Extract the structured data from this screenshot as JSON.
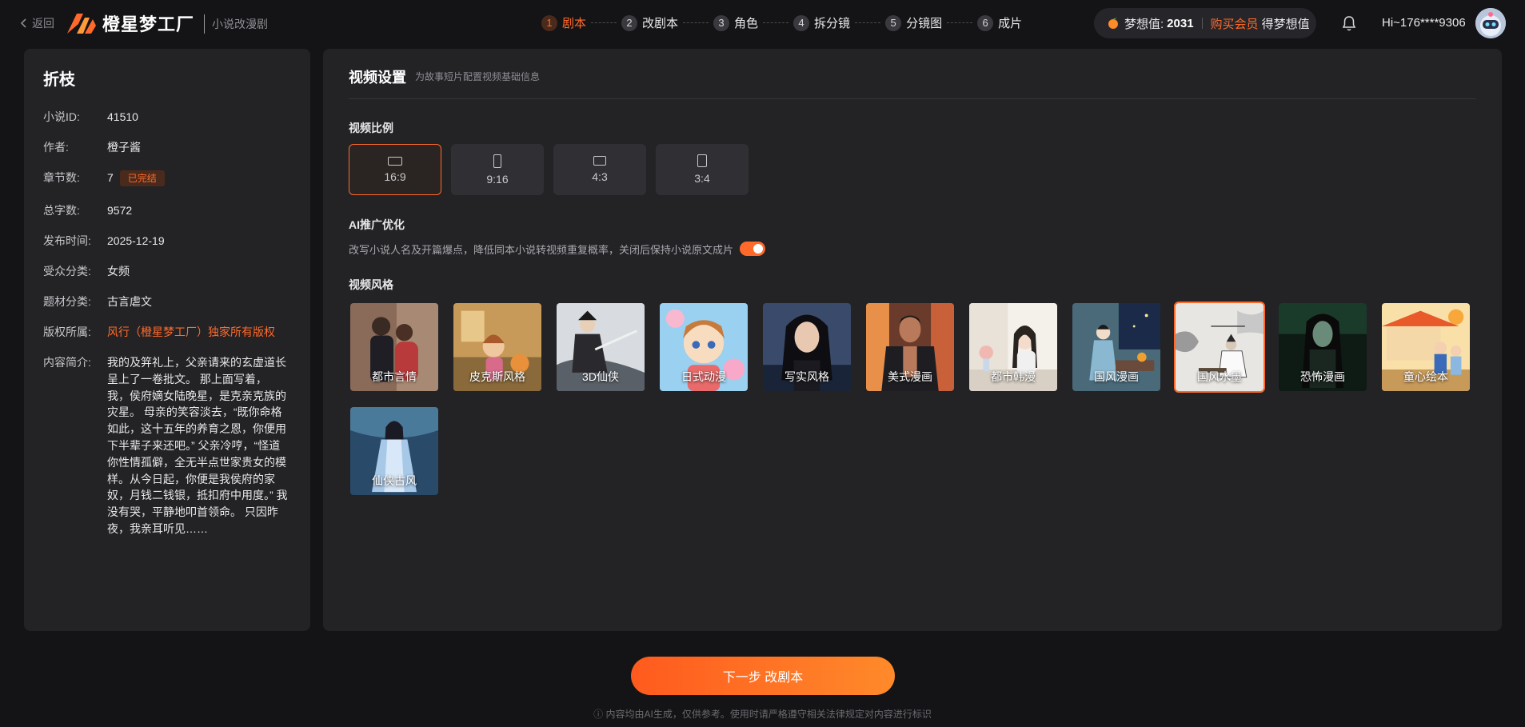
{
  "header": {
    "back_label": "返回",
    "logo_text": "橙星梦工厂",
    "logo_subtitle": "小说改漫剧",
    "steps": [
      {
        "num": "1",
        "label": "剧本"
      },
      {
        "num": "2",
        "label": "改剧本"
      },
      {
        "num": "3",
        "label": "角色"
      },
      {
        "num": "4",
        "label": "拆分镜"
      },
      {
        "num": "5",
        "label": "分镜图"
      },
      {
        "num": "6",
        "label": "成片"
      }
    ],
    "dream_label": "梦想值:",
    "dream_value": "2031",
    "buy_member": "购买会员",
    "earn_dream": "得梦想值",
    "user_greeting": "Hi~176****9306"
  },
  "novel": {
    "title": "折枝",
    "fields": [
      {
        "key": "小说ID:",
        "value": "41510"
      },
      {
        "key": "作者:",
        "value": "橙子酱"
      },
      {
        "key": "章节数:",
        "value": "7",
        "badge": "已完结"
      },
      {
        "key": "总字数:",
        "value": "9572"
      },
      {
        "key": "发布时间:",
        "value": "2025-12-19"
      },
      {
        "key": "受众分类:",
        "value": "女频"
      },
      {
        "key": "题材分类:",
        "value": "古言虐文"
      },
      {
        "key": "版权所属:",
        "value": "风行（橙星梦工厂）独家所有版权"
      }
    ],
    "summary_key": "内容简介:",
    "summary": "我的及笄礼上，父亲请来的玄虚道长呈上了一卷批文。 那上面写着，我，侯府嫡女陆晚星，是克亲克族的灾星。 母亲的笑容淡去，“既你命格如此，这十五年的养育之恩，你便用下半辈子来还吧。” 父亲冷哼，“怪道你性情孤僻，全无半点世家贵女的模样。从今日起，你便是我侯府的家奴，月钱二钱银，抵扣府中用度。” 我没有哭，平静地叩首领命。 只因昨夜，我亲耳听见……"
  },
  "settings": {
    "title": "视频设置",
    "subtitle": "为故事短片配置视频基础信息",
    "ratio_label": "视频比例",
    "ratios": [
      "16:9",
      "9:16",
      "4:3",
      "3:4"
    ],
    "selected_ratio": "16:9",
    "ai_label": "AI推广优化",
    "ai_desc": "改写小说人名及开篇爆点，降低同本小说转视频重复概率，关闭后保持小说原文成片",
    "ai_enabled": true,
    "style_label": "视频风格",
    "styles": [
      "都市言情",
      "皮克斯风格",
      "3D仙侠",
      "日式动漫",
      "写实风格",
      "美式漫画",
      "都市韩漫",
      "国风漫画",
      "国风水墨",
      "恐怖漫画",
      "童心绘本",
      "仙侠古风"
    ],
    "selected_style": "国风水墨"
  },
  "footer": {
    "next_button": "下一步 改剧本",
    "disclaimer": "ⓘ 内容均由AI生成，仅供参考。使用时请严格遵守相关法律规定对内容进行标识"
  },
  "colors": {
    "accent": "#ff6a2a",
    "background": "#141416",
    "panel": "#232326"
  }
}
